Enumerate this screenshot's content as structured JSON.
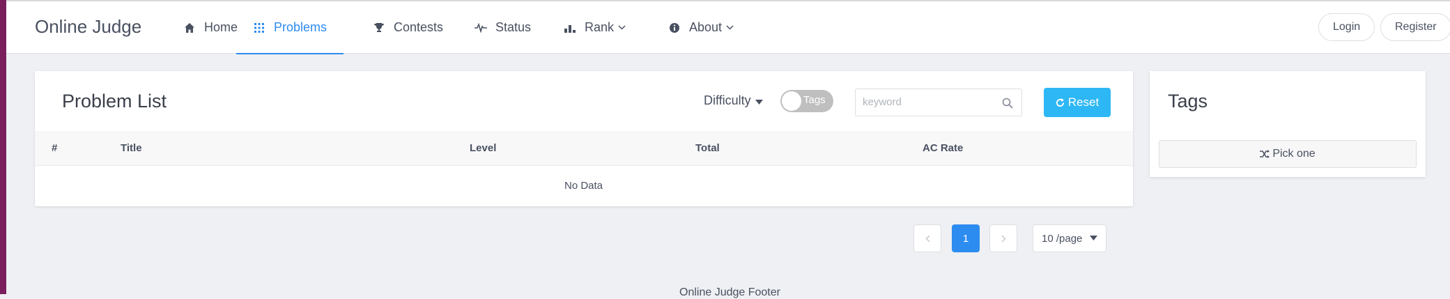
{
  "header": {
    "brand": "Online Judge",
    "nav": [
      {
        "label": "Home",
        "icon": "home-icon"
      },
      {
        "label": "Problems",
        "icon": "grid-icon",
        "active": true
      },
      {
        "label": "Contests",
        "icon": "trophy-icon"
      },
      {
        "label": "Status",
        "icon": "pulse-icon"
      },
      {
        "label": "Rank",
        "icon": "bar-chart-icon",
        "dropdown": true
      },
      {
        "label": "About",
        "icon": "info-icon",
        "dropdown": true
      }
    ],
    "login_label": "Login",
    "register_label": "Register"
  },
  "problem_list": {
    "title": "Problem List",
    "difficulty_label": "Difficulty",
    "tags_toggle_label": "Tags",
    "tags_toggle_on": false,
    "search_placeholder": "keyword",
    "reset_label": "Reset",
    "columns": [
      "#",
      "Title",
      "Level",
      "Total",
      "AC Rate"
    ],
    "empty_text": "No Data"
  },
  "pagination": {
    "current_page": "1",
    "page_size_label": "10 /page"
  },
  "tags_panel": {
    "title": "Tags",
    "pick_one_label": "Pick one"
  },
  "footer": {
    "text": "Online Judge Footer"
  },
  "colors": {
    "accent": "#2d8cf0",
    "reset_button": "#2db7f5",
    "background": "#eef0f3"
  }
}
